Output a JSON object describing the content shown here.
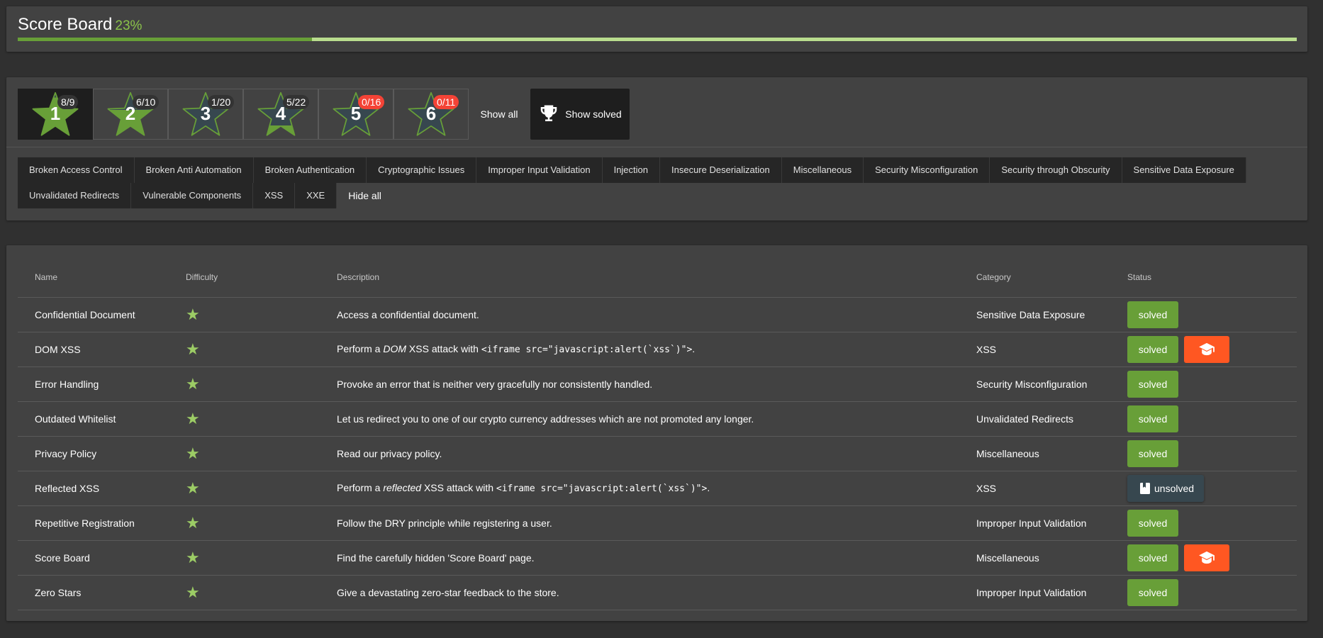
{
  "header": {
    "title": "Score Board",
    "percent_text": "23%",
    "progress_fraction": 0.23
  },
  "difficulty_filters": [
    {
      "level": "1",
      "count": "8/9",
      "fill_fraction": 0.89,
      "badge_red": false,
      "active": true
    },
    {
      "level": "2",
      "count": "6/10",
      "fill_fraction": 0.6,
      "badge_red": false,
      "active": false
    },
    {
      "level": "3",
      "count": "1/20",
      "fill_fraction": 0.05,
      "badge_red": false,
      "active": false
    },
    {
      "level": "4",
      "count": "5/22",
      "fill_fraction": 0.23,
      "badge_red": false,
      "active": false
    },
    {
      "level": "5",
      "count": "0/16",
      "fill_fraction": 0,
      "badge_red": true,
      "active": false
    },
    {
      "level": "6",
      "count": "0/11",
      "fill_fraction": 0,
      "badge_red": true,
      "active": false
    }
  ],
  "show_all_label": "Show all",
  "show_solved_label": "Show solved",
  "categories_row1": [
    "Broken Access Control",
    "Broken Anti Automation",
    "Broken Authentication",
    "Cryptographic Issues",
    "Improper Input Validation",
    "Injection",
    "Insecure Deserialization",
    "Miscellaneous",
    "Security Misconfiguration",
    "Security through Obscurity",
    "Sensitive Data Exposure"
  ],
  "categories_row2": [
    "Unvalidated Redirects",
    "Vulnerable Components",
    "XSS",
    "XXE"
  ],
  "hide_all_label": "Hide all",
  "table": {
    "headers": {
      "name": "Name",
      "difficulty": "Difficulty",
      "description": "Description",
      "category": "Category",
      "status": "Status"
    },
    "rows": [
      {
        "name": "Confidential Document",
        "stars": "★",
        "description": [
          {
            "t": "text",
            "v": "Access a confidential document."
          }
        ],
        "category": "Sensitive Data Exposure",
        "status": "solved",
        "hint": false
      },
      {
        "name": "DOM XSS",
        "stars": "★",
        "description": [
          {
            "t": "text",
            "v": "Perform a "
          },
          {
            "t": "em",
            "v": "DOM"
          },
          {
            "t": "text",
            "v": " XSS attack with "
          },
          {
            "t": "code",
            "v": "<iframe src=\"javascript:alert(`xss`)\">"
          },
          {
            "t": "text",
            "v": "."
          }
        ],
        "category": "XSS",
        "status": "solved",
        "hint": true
      },
      {
        "name": "Error Handling",
        "stars": "★",
        "description": [
          {
            "t": "text",
            "v": "Provoke an error that is neither very gracefully nor consistently handled."
          }
        ],
        "category": "Security Misconfiguration",
        "status": "solved",
        "hint": false
      },
      {
        "name": "Outdated Whitelist",
        "stars": "★",
        "description": [
          {
            "t": "text",
            "v": "Let us redirect you to one of our crypto currency addresses which are not promoted any longer."
          }
        ],
        "category": "Unvalidated Redirects",
        "status": "solved",
        "hint": false
      },
      {
        "name": "Privacy Policy",
        "stars": "★",
        "description": [
          {
            "t": "text",
            "v": "Read our privacy policy."
          }
        ],
        "category": "Miscellaneous",
        "status": "solved",
        "hint": false
      },
      {
        "name": "Reflected XSS",
        "stars": "★",
        "description": [
          {
            "t": "text",
            "v": "Perform a "
          },
          {
            "t": "em",
            "v": "reflected"
          },
          {
            "t": "text",
            "v": " XSS attack with "
          },
          {
            "t": "code",
            "v": "<iframe src=\"javascript:alert(`xss`)\">"
          },
          {
            "t": "text",
            "v": "."
          }
        ],
        "category": "XSS",
        "status": "unsolved",
        "hint": false
      },
      {
        "name": "Repetitive Registration",
        "stars": "★",
        "description": [
          {
            "t": "text",
            "v": "Follow the DRY principle while registering a user."
          }
        ],
        "category": "Improper Input Validation",
        "status": "solved",
        "hint": false
      },
      {
        "name": "Score Board",
        "stars": "★",
        "description": [
          {
            "t": "text",
            "v": "Find the carefully hidden 'Score Board' page."
          }
        ],
        "category": "Miscellaneous",
        "status": "solved",
        "hint": true
      },
      {
        "name": "Zero Stars",
        "stars": "★",
        "description": [
          {
            "t": "text",
            "v": "Give a devastating zero-star feedback to the store."
          }
        ],
        "category": "Improper Input Validation",
        "status": "solved",
        "hint": false
      }
    ]
  },
  "colors": {
    "background": "#303030",
    "card": "#424242",
    "accent_green": "#689f38",
    "progress_track": "#b9dd8e",
    "star_green": "#689f38",
    "star_empty": "#37474f",
    "badge_red": "#f44336",
    "hint_orange": "#ff5722",
    "unsolved_button": "#37474f"
  },
  "icons": {
    "trophy": "trophy-icon",
    "hint": "graduation-cap-icon",
    "unsolved": "book-icon",
    "difficulty": "star-icon"
  }
}
